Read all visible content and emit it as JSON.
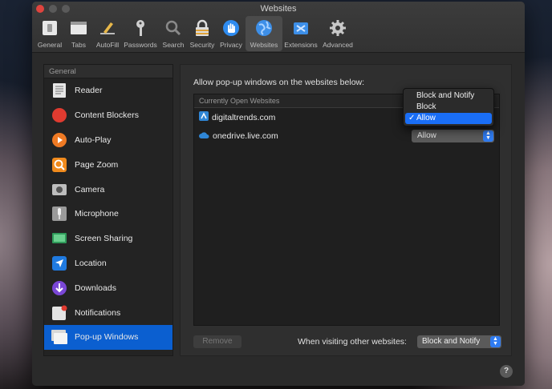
{
  "window": {
    "title": "Websites"
  },
  "toolbar": {
    "items": [
      {
        "label": "General",
        "icon": "general-switch-icon"
      },
      {
        "label": "Tabs",
        "icon": "tabs-icon"
      },
      {
        "label": "AutoFill",
        "icon": "autofill-pencil-icon"
      },
      {
        "label": "Passwords",
        "icon": "key-icon"
      },
      {
        "label": "Search",
        "icon": "magnifier-icon"
      },
      {
        "label": "Security",
        "icon": "lock-icon"
      },
      {
        "label": "Privacy",
        "icon": "privacy-hand-icon"
      },
      {
        "label": "Websites",
        "icon": "globe-icon",
        "selected": true
      },
      {
        "label": "Extensions",
        "icon": "puzzle-icon"
      },
      {
        "label": "Advanced",
        "icon": "gear-icon"
      }
    ]
  },
  "sidebar": {
    "header": "General",
    "items": [
      {
        "label": "Reader",
        "icon": "reader-icon"
      },
      {
        "label": "Content Blockers",
        "icon": "stop-icon"
      },
      {
        "label": "Auto-Play",
        "icon": "play-icon"
      },
      {
        "label": "Page Zoom",
        "icon": "zoom-icon"
      },
      {
        "label": "Camera",
        "icon": "camera-icon"
      },
      {
        "label": "Microphone",
        "icon": "microphone-icon"
      },
      {
        "label": "Screen Sharing",
        "icon": "screen-sharing-icon"
      },
      {
        "label": "Location",
        "icon": "location-arrow-icon"
      },
      {
        "label": "Downloads",
        "icon": "download-icon"
      },
      {
        "label": "Notifications",
        "icon": "notification-icon"
      },
      {
        "label": "Pop-up Windows",
        "icon": "popup-window-icon",
        "selected": true
      }
    ]
  },
  "main": {
    "heading": "Allow pop-up windows on the websites below:",
    "list_header": "Currently Open Websites",
    "sites": [
      {
        "name": "digitaltrends.com",
        "setting": "Allow"
      },
      {
        "name": "onedrive.live.com",
        "setting": "Allow"
      }
    ],
    "menu": {
      "options": [
        "Block and Notify",
        "Block",
        "Allow"
      ],
      "selected": "Allow",
      "check": "✓"
    },
    "remove_label": "Remove",
    "other_label": "When visiting other websites:",
    "other_value": "Block and Notify",
    "help_label": "?"
  },
  "colors": {
    "accent": "#0b5fd0",
    "menu_highlight": "#1a6ef5",
    "close": "#e0443e"
  }
}
